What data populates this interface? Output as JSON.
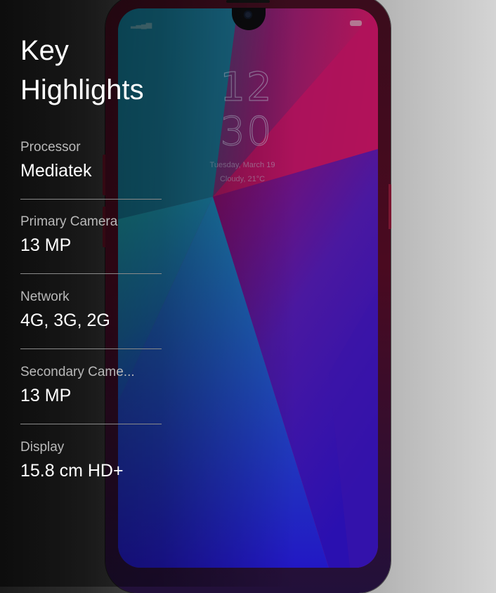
{
  "panel": {
    "title_line1": "Key",
    "title_line2": "Highlights",
    "specs": [
      {
        "label": "Processor",
        "value": "Mediatek"
      },
      {
        "label": "Primary Camera",
        "value": "13 MP"
      },
      {
        "label": "Network",
        "value": "4G, 3G, 2G"
      },
      {
        "label": "Secondary Came...",
        "value": "13 MP"
      },
      {
        "label": "Display",
        "value": "15.8 cm HD+"
      }
    ]
  },
  "lockscreen": {
    "hour": "12",
    "minute": "30",
    "date": "Tuesday, March 19",
    "weather": "Cloudy, 21°C",
    "signal_icon": "signal-bars-icon",
    "battery_icon": "battery-icon"
  },
  "colors": {
    "wallpaper_magenta": "#c0145a",
    "wallpaper_teal": "#1f8fa0",
    "wallpaper_blue": "#2a1ab8"
  }
}
